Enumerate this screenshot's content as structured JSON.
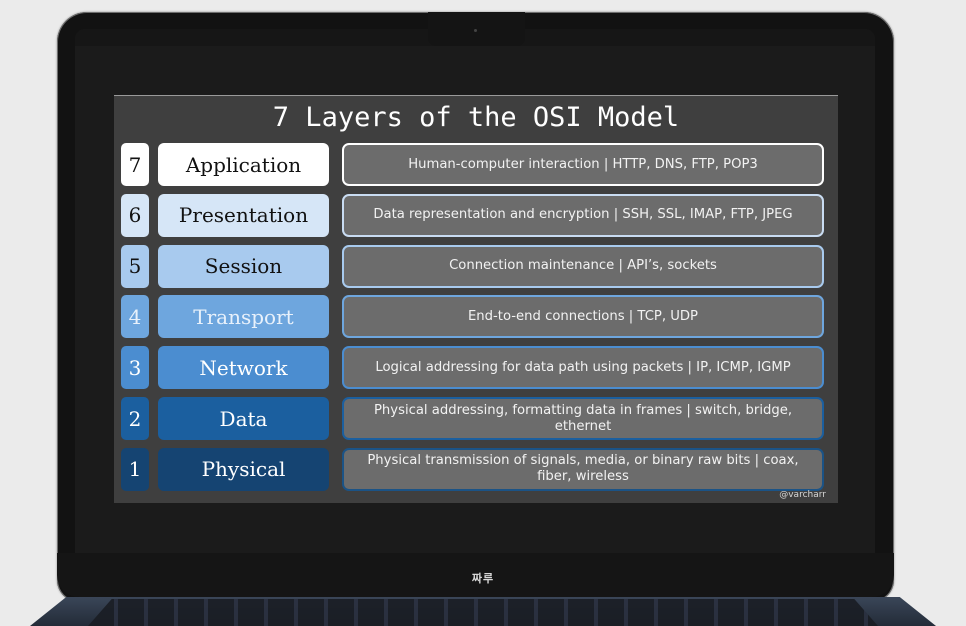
{
  "slide": {
    "title": "7 Layers of the OSI Model",
    "credit": "@varcharr",
    "layers": [
      {
        "number": "7",
        "name": "Application",
        "description": "Human-computer interaction | HTTP, DNS, FTP, POP3",
        "fill": "#ffffff",
        "text_color": "#111111",
        "border": "#ffffff"
      },
      {
        "number": "6",
        "name": "Presentation",
        "description": "Data representation and encryption | SSH, SSL, IMAP, FTP, JPEG",
        "fill": "#d6e6f7",
        "text_color": "#111111",
        "border": "#c9dcf2"
      },
      {
        "number": "5",
        "name": "Session",
        "description": "Connection maintenance | API’s, sockets",
        "fill": "#a8caee",
        "text_color": "#111111",
        "border": "#a8caee"
      },
      {
        "number": "4",
        "name": "Transport",
        "description": "End-to-end connections | TCP, UDP",
        "fill": "#6ea6de",
        "text_color": "#e8f1fb",
        "border": "#6ea6de"
      },
      {
        "number": "3",
        "name": "Network",
        "description": "Logical addressing for data path using packets | IP, ICMP, IGMP",
        "fill": "#4b8dd0",
        "text_color": "#ffffff",
        "border": "#4b8dd0"
      },
      {
        "number": "2",
        "name": "Data",
        "description": "Physical addressing, formatting data in frames | switch, bridge, ethernet",
        "fill": "#1b5f9f",
        "text_color": "#ffffff",
        "border": "#1b5f9f"
      },
      {
        "number": "1",
        "name": "Physical",
        "description": "Physical transmission of signals, media, or binary raw bits | coax, fiber, wireless",
        "fill": "#154472",
        "text_color": "#ffffff",
        "border": "#1b5386"
      }
    ]
  },
  "device": {
    "brand_label": "짜루"
  }
}
